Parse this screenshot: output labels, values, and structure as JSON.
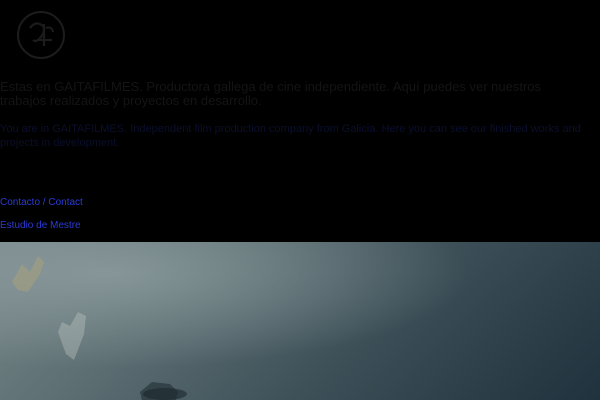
{
  "header": {
    "logo_icon": "gaitafilmes-logo-icon"
  },
  "intro": {
    "es": "Estas en GAITAFILMES. Productora gallega de cine independiente. Aquí puedes ver nuestros trabajos realizados y proyectos en desarrollo.",
    "en": "You are in GAITAFILMES. Independent film production company from Galicia. Here you can see our finished works and projects in development."
  },
  "nav": {
    "contact_label": "Contacto / Contact",
    "studio_label": "Estudio de Mestre"
  },
  "colors": {
    "background": "#000000",
    "link": "#2b3bd6"
  }
}
